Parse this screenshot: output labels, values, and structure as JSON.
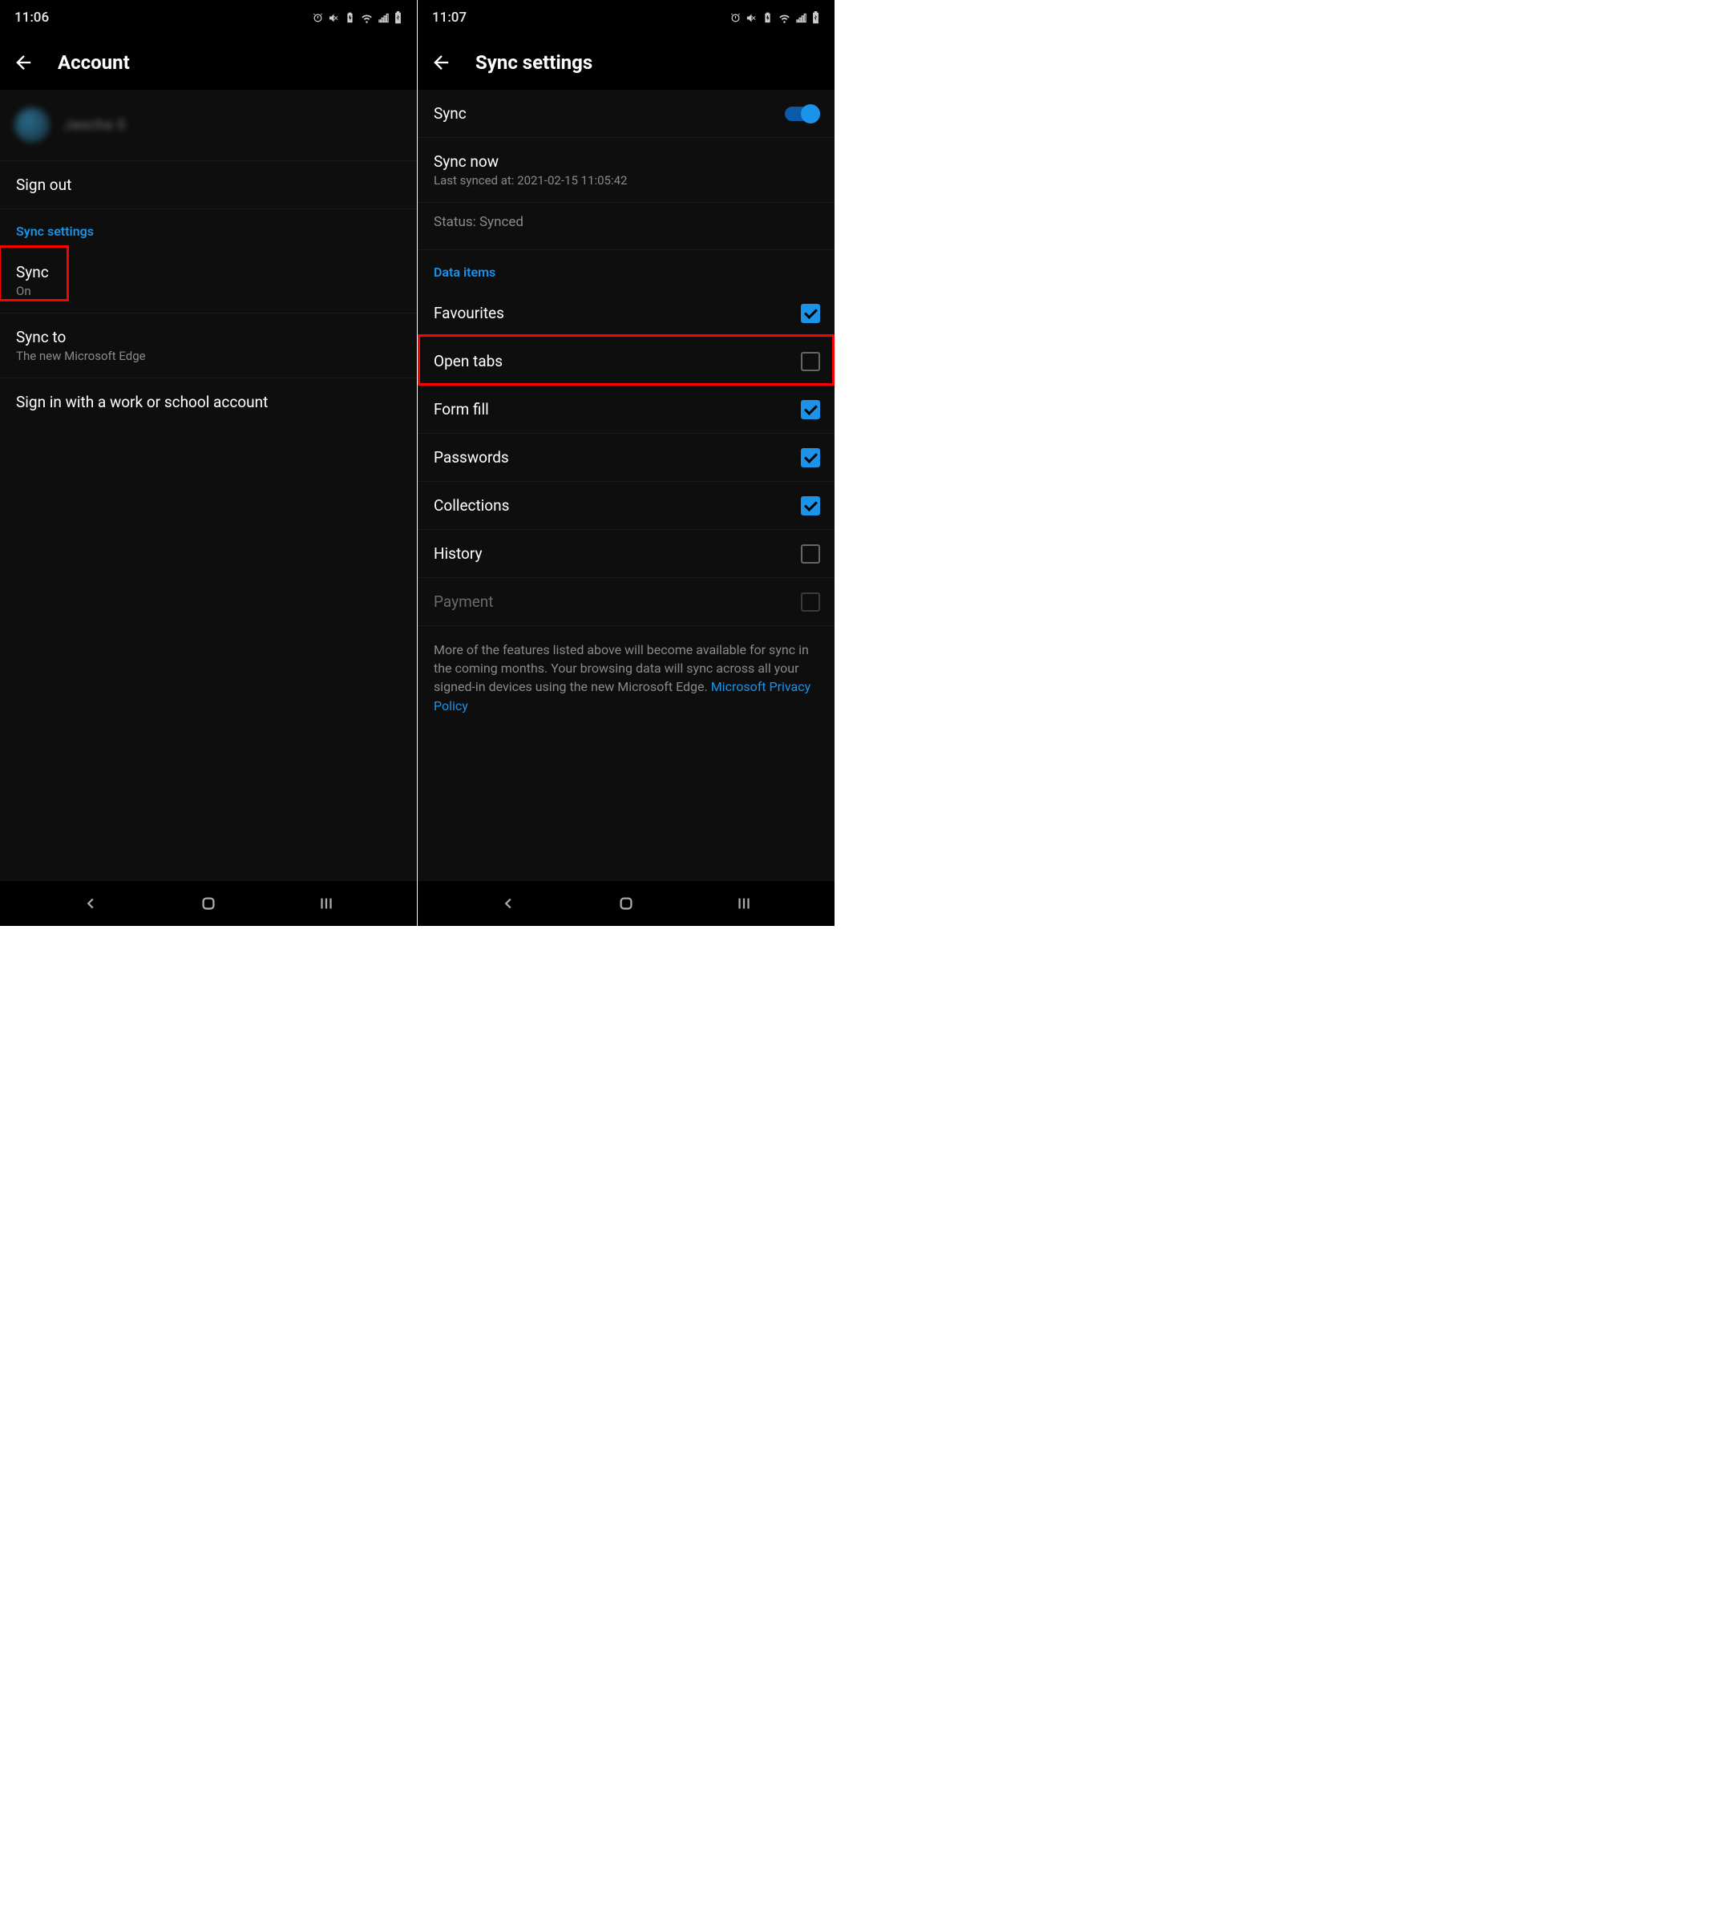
{
  "left": {
    "status_time": "11:06",
    "header_title": "Account",
    "account_name": "Jascha S",
    "items": {
      "signout": "Sign out",
      "sync_settings_header": "Sync settings",
      "sync_label": "Sync",
      "sync_value": "On",
      "syncto_label": "Sync to",
      "syncto_value": "The new Microsoft Edge",
      "signin_work": "Sign in with a work or school account"
    }
  },
  "right": {
    "status_time": "11:07",
    "header_title": "Sync settings",
    "sync_toggle_label": "Sync",
    "sync_now_label": "Sync now",
    "sync_now_sub": "Last synced at: 2021-02-15 11:05:42",
    "status_label": "Status: Synced",
    "data_items_header": "Data items",
    "items": {
      "favourites": "Favourites",
      "open_tabs": "Open tabs",
      "form_fill": "Form fill",
      "passwords": "Passwords",
      "collections": "Collections",
      "history": "History",
      "payment": "Payment"
    },
    "footer_text": "More of the features listed above will become available for sync in the coming months. Your browsing data will sync across all your signed-in devices using the new Microsoft Edge. ",
    "footer_link": "Microsoft Privacy Policy"
  }
}
